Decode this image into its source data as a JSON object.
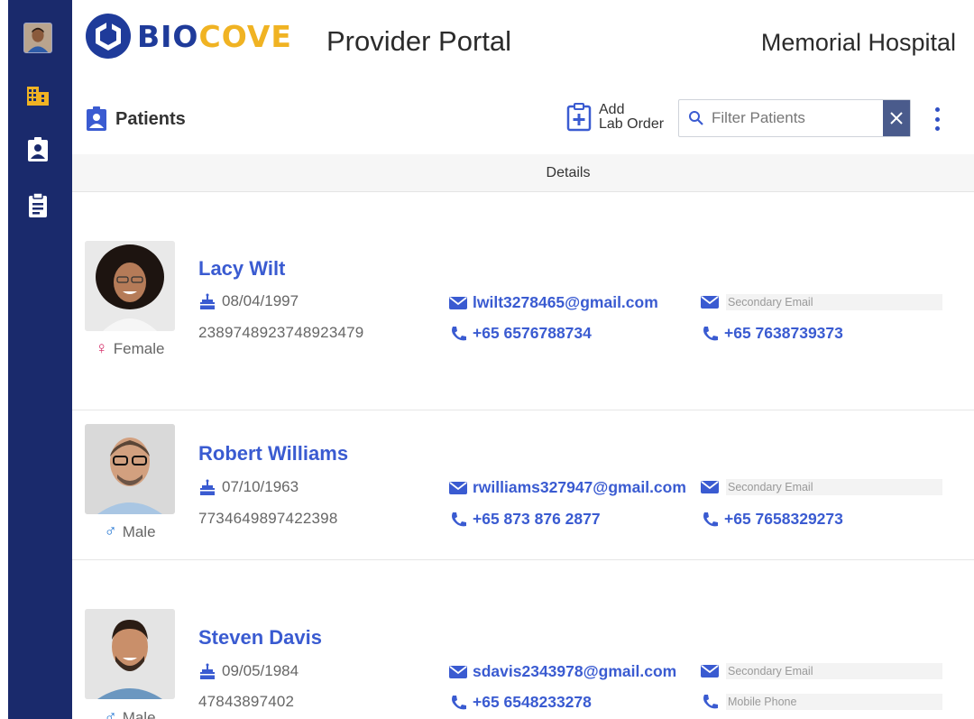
{
  "header": {
    "logo_bio": "BIO",
    "logo_cove": "COVE",
    "portal_title": "Provider Portal",
    "hospital": "Memorial Hospital"
  },
  "sidebar": {
    "items": [
      {
        "name": "avatar"
      },
      {
        "name": "building-icon",
        "active": true,
        "color": "#f0b323"
      },
      {
        "name": "patient-badge-icon"
      },
      {
        "name": "clipboard-icon"
      }
    ]
  },
  "toolbar": {
    "section_title": "Patients",
    "add_label_line1": "Add",
    "add_label_line2": "Lab Order",
    "filter_placeholder": "Filter Patients"
  },
  "table": {
    "column_header": "Details"
  },
  "patients": [
    {
      "name": "Lacy Wilt",
      "dob": "08/04/1997",
      "id": "2389748923748923479",
      "gender": "Female",
      "gender_symbol": "♀",
      "email": "lwilt3278465@gmail.com",
      "phone": "+65 6576788734",
      "secondary_email": "Secondary Email",
      "mobile_phone": "+65 7638739373"
    },
    {
      "name": "Robert Williams",
      "dob": "07/10/1963",
      "id": "7734649897422398",
      "gender": "Male",
      "gender_symbol": "♂",
      "email": "rwilliams327947@gmail.com",
      "phone": "+65 873 876 2877",
      "secondary_email": "Secondary Email",
      "mobile_phone": "+65 7658329273"
    },
    {
      "name": "Steven Davis",
      "dob": "09/05/1984",
      "id": "47843897402",
      "gender": "Male",
      "gender_symbol": "♂",
      "email": "sdavis2343978@gmail.com",
      "phone": "+65 6548233278",
      "secondary_email": "Secondary Email",
      "mobile_phone_placeholder": "Mobile Phone"
    }
  ],
  "colors": {
    "sidebar": "#1a2a6c",
    "accent": "#3a5bd1",
    "brand_blue": "#1f3b9a",
    "brand_gold": "#f0b323",
    "female": "#d6336c",
    "male": "#1e73d2"
  }
}
